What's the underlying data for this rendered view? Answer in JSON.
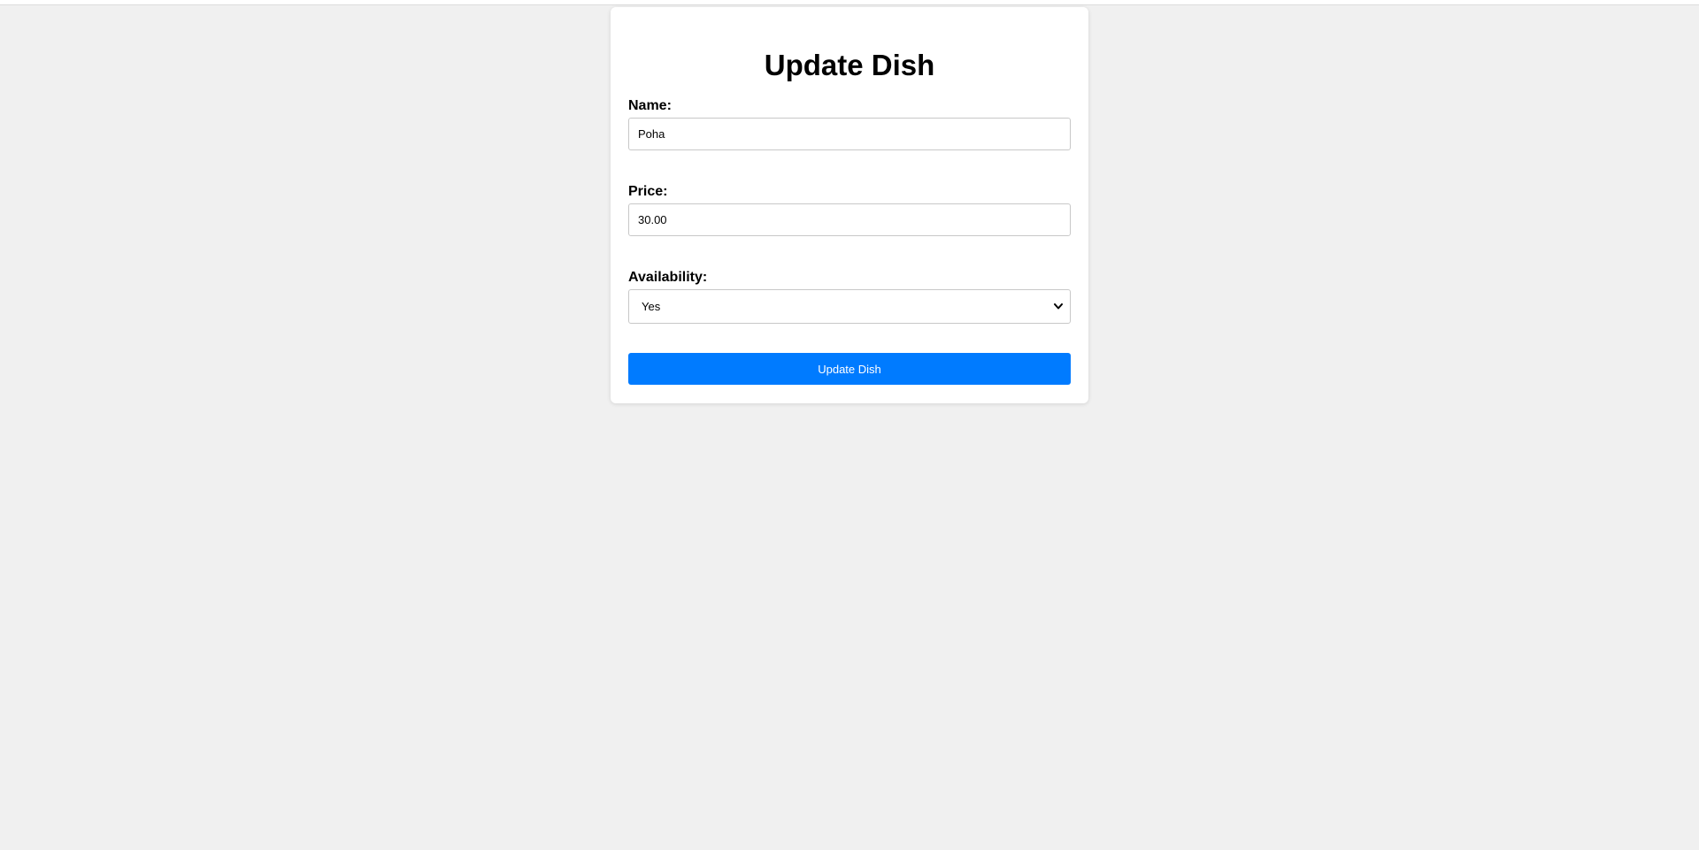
{
  "form": {
    "title": "Update Dish",
    "name": {
      "label": "Name:",
      "value": "Poha"
    },
    "price": {
      "label": "Price:",
      "value": "30.00"
    },
    "availability": {
      "label": "Availability:",
      "selected": "Yes"
    },
    "submit_label": "Update Dish"
  },
  "colors": {
    "background": "#f0f0f0",
    "card": "#ffffff",
    "accent": "#007bff"
  },
  "icons": {
    "select_arrow": "chevron-down-icon"
  }
}
